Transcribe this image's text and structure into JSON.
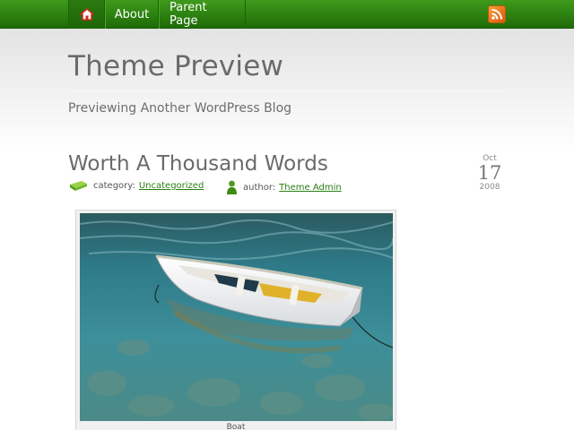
{
  "nav": {
    "home_icon": "home-icon",
    "items": [
      {
        "label": "About"
      },
      {
        "label": "Parent Page"
      }
    ],
    "rss_icon": "rss-icon"
  },
  "header": {
    "title": "Theme Preview",
    "tagline": "Previewing Another WordPress Blog"
  },
  "post": {
    "title": "Worth A Thousand Words",
    "date": {
      "month": "Oct",
      "day": "17",
      "year": "2008"
    },
    "category_label": "category:",
    "category": "Uncategorized",
    "author_label": "author:",
    "author": "Theme Admin",
    "image_caption": "Boat"
  },
  "colors": {
    "nav_green": "#2c8110",
    "link_green": "#2a7f12",
    "rss_orange": "#e8711a"
  }
}
